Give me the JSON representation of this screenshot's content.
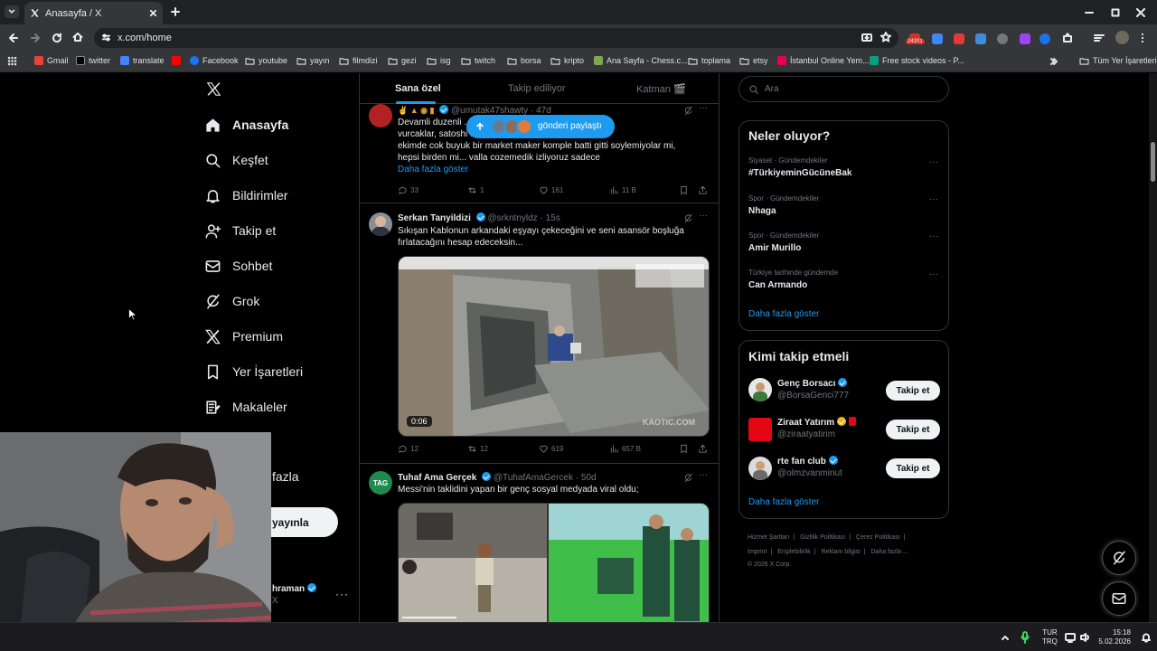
{
  "browser": {
    "tab_title": "Anasayfa / X",
    "url": "x.com/home",
    "ext_badge": "24201",
    "bookmarks": [
      "Gmail",
      "twitter",
      "translate",
      "Facebook",
      "youtube",
      "yayın",
      "filmdizi",
      "gezi",
      "isg",
      "twitch",
      "borsa",
      "kripto",
      "Ana Sayfa - Chess.c...",
      "toplama",
      "etsy",
      "İstanbul Online Yem...",
      "Free stock videos - P..."
    ],
    "all_bookmarks": "Tüm Yer İşaretleri"
  },
  "nav": {
    "items": [
      "Anasayfa",
      "Keşfet",
      "Bildirimler",
      "Takip et",
      "Sohbet",
      "Grok",
      "Premium",
      "Yer İşaretleri",
      "Makaleler"
    ],
    "more_partial": "fazla",
    "post_partial": "yayınla",
    "account_name_partial": "hraman",
    "account_handle_partial": "X"
  },
  "feed": {
    "tabs": [
      "Sana özel",
      "Takip ediliyor",
      "Katman 🎬"
    ],
    "new_posts_pill": "gönderi paylaştı",
    "posts": [
      {
        "handle": "@umutak47shawty",
        "time": "47d",
        "lines": [
          "Devamli duzenli ...atliyoruz... artik irani mi",
          "vurcaklar, satoshi ...nin mi pesindeler, 10",
          "ekimde cok buyuk bir market maker komple batti gitti soylemiyolar mi,",
          "hepsi birden mi... valla cozemedik izliyoruz sadece"
        ],
        "show_more": "Daha fazla göster",
        "replies": "33",
        "reposts": "1",
        "likes": "161",
        "views": "11 B"
      },
      {
        "name": "Serkan Tanyildizi",
        "handle": "@srkntnyldz",
        "time": "15s",
        "lines": [
          "Sıkışan Kablonun arkandaki eşyayı çekeceğini ve seni asansör boşluğa",
          "fırlatacağını hesap edeceksin..."
        ],
        "video_duration": "0:06",
        "video_watermark": "KAOTIC.COM",
        "replies": "12",
        "reposts": "12",
        "likes": "619",
        "views": "657 B"
      },
      {
        "name": "Tuhaf Ama Gerçek",
        "handle": "@TuhafAmaGercek",
        "time": "50d",
        "avatar_text": "TAG",
        "lines": [
          "Messi'nin taklidini yapan bir genç sosyal medyada viral oldu;"
        ]
      }
    ]
  },
  "right": {
    "search_placeholder": "Ara",
    "trends_title": "Neler oluyor?",
    "trends": [
      {
        "cat": "Siyaset · Gündemdekiler",
        "name": "#TürkiyeminGücüneBak"
      },
      {
        "cat": "Spor · Gündemdekiler",
        "name": "Nhaga"
      },
      {
        "cat": "Spor · Gündemdekiler",
        "name": "Amir Murillo"
      },
      {
        "cat": "Türkiye tarihinde gündemde",
        "name": "Can Armando"
      }
    ],
    "trends_more": "Daha fazla göster",
    "who_title": "Kimi takip etmeli",
    "suggestions": [
      {
        "name": "Genç Borsacı",
        "handle": "@BorsaGenci777",
        "button": "Takip et"
      },
      {
        "name": "Ziraat Yatırım",
        "handle": "@ziraatyatirim",
        "button": "Takip et"
      },
      {
        "name": "rte fan club",
        "handle": "@olmzvanminut",
        "button": "Takip et"
      }
    ],
    "who_more": "Daha fazla göster",
    "footer": [
      "Hizmet Şartları",
      "Gizlilik Politikası",
      "Çerez Politikası",
      "İmprint",
      "Erişilebilirlik",
      "Reklam bilgisi",
      "Daha fazla ...",
      "© 2026 X Corp."
    ]
  },
  "taskbar": {
    "lang1": "TUR",
    "lang2": "TRQ",
    "time": "15:18",
    "date": "5.02.2026"
  },
  "colors": {
    "accent": "#1d9bf0",
    "bg": "#000000",
    "border": "#2f3336",
    "muted": "#71767b"
  }
}
